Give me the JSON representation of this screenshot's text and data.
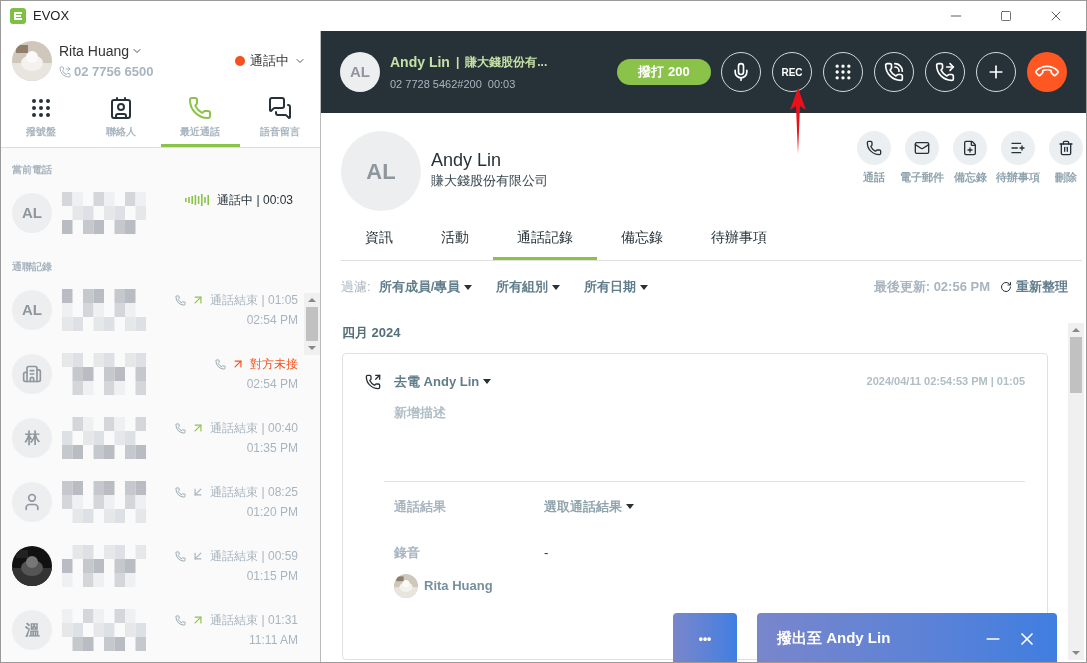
{
  "window": {
    "title": "EVOX"
  },
  "user": {
    "name": "Rita Huang",
    "phone": "02 7756 6500",
    "status": "通話中"
  },
  "nav_tabs": [
    {
      "kind": "dialpad",
      "label": "撥號盤",
      "selected": false
    },
    {
      "kind": "contacts",
      "label": "聯絡人",
      "selected": false
    },
    {
      "kind": "recent",
      "label": "最近通話",
      "selected": true
    },
    {
      "kind": "voicemail",
      "label": "語音留言",
      "selected": false
    }
  ],
  "current_call": {
    "section": "當前電話",
    "avatar": "AL",
    "status": "通話中 | 00:03"
  },
  "history": {
    "section": "通聯記錄",
    "items": [
      {
        "kind": "initials",
        "initials": "AL",
        "outgoing": true,
        "missed": false,
        "status": "通話結束 | 01:05",
        "time": "02:54 PM"
      },
      {
        "kind": "building",
        "outgoing": true,
        "missed": true,
        "status": "對方未接",
        "time": "02:54 PM"
      },
      {
        "kind": "initials",
        "initials": "林",
        "outgoing": true,
        "missed": false,
        "status": "通話結束 | 00:40",
        "time": "01:35 PM"
      },
      {
        "kind": "person",
        "outgoing": false,
        "missed": false,
        "status": "通話結束 | 08:25",
        "time": "01:20 PM"
      },
      {
        "outgoing": false,
        "missed": false,
        "status": "通話結束 | 00:59",
        "time": "01:15 PM"
      },
      {
        "kind": "initials",
        "initials": "溫",
        "outgoing": true,
        "missed": false,
        "status": "通話結束 | 01:31",
        "time": "11:11 AM"
      }
    ]
  },
  "call_bar": {
    "avatar": "AL",
    "name": "Andy Lin",
    "separator": "|",
    "company": "賺大錢股份有...",
    "number": "02 7728 5462#200",
    "duration": "00:03",
    "dial_button": "撥打 200",
    "controls": [
      {
        "kind": "mic"
      },
      {
        "kind": "rec",
        "label": "REC"
      },
      {
        "kind": "dialpad"
      },
      {
        "kind": "hold"
      },
      {
        "kind": "transfer"
      },
      {
        "kind": "add"
      },
      {
        "kind": "hangup"
      }
    ]
  },
  "contact": {
    "avatar": "AL",
    "name": "Andy Lin",
    "company": "賺大錢股份有限公司",
    "actions": [
      {
        "kind": "call",
        "label": "通話"
      },
      {
        "kind": "email",
        "label": "電子郵件"
      },
      {
        "kind": "memo",
        "label": "備忘錄"
      },
      {
        "kind": "todo",
        "label": "待辦事項"
      },
      {
        "kind": "delete",
        "label": "刪除"
      }
    ]
  },
  "tabs": [
    {
      "label": "資訊",
      "selected": false
    },
    {
      "label": "活動",
      "selected": false
    },
    {
      "label": "通話記錄",
      "selected": true
    },
    {
      "label": "備忘錄",
      "selected": false
    },
    {
      "label": "待辦事項",
      "selected": false
    }
  ],
  "filters": {
    "label": "過濾:",
    "dropdowns": [
      "所有成員/專員",
      "所有組別",
      "所有日期"
    ],
    "last_updated": "最後更新: 02:56 PM",
    "refresh": "重新整理"
  },
  "month": "四月 2024",
  "record": {
    "title": "去電 Andy Lin",
    "timestamp": "2024/04/11 02:54:53 PM | 01:05",
    "description_placeholder": "新增描述",
    "fields": [
      {
        "kind": "dropdown",
        "label": "通話結果",
        "value": "選取通話結果"
      },
      {
        "kind": "text",
        "label": "錄音",
        "value": "-"
      }
    ],
    "owner": "Rita Huang"
  },
  "more_button": "•••",
  "call_toast": {
    "title": "撥出至 Andy Lin"
  }
}
